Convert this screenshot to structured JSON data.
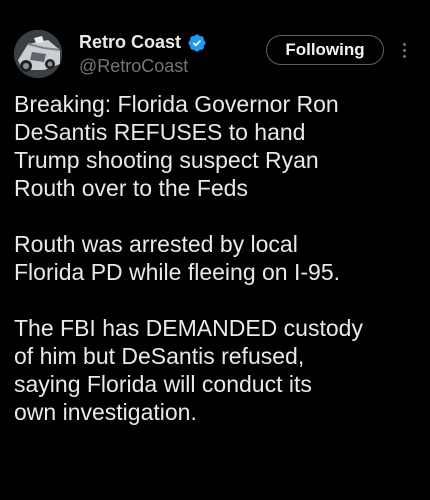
{
  "author": {
    "display_name": "Retro Coast",
    "handle": "@RetroCoast",
    "verified": true
  },
  "actions": {
    "follow_label": "Following"
  },
  "icons": {
    "avatar": "car-avatar",
    "verified": "verified-badge-icon",
    "more": "more-options-icon"
  },
  "colors": {
    "background": "#000000",
    "text": "#e7e9ea",
    "secondary_text": "#71767b",
    "verified_blue": "#1d9bf0"
  },
  "tweet": {
    "paragraphs": [
      "Breaking: Florida Governor Ron\nDeSantis REFUSES to hand\nTrump shooting suspect Ryan\nRouth over to the Feds",
      "Routh was arrested by local\nFlorida PD while fleeing on I-95.",
      "The FBI has DEMANDED custody\nof him but DeSantis refused,\nsaying Florida will conduct its\nown investigation."
    ]
  }
}
